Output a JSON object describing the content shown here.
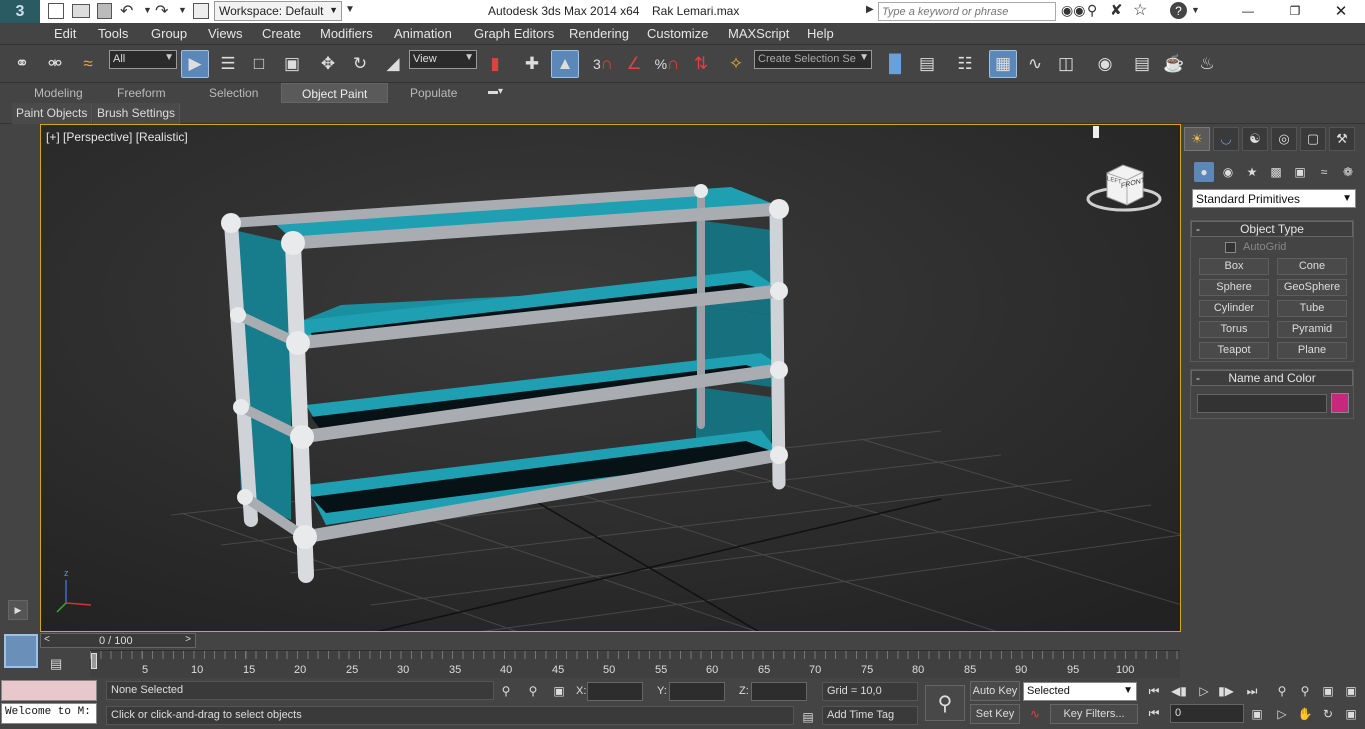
{
  "titlebar": {
    "app_icon_label": "3",
    "workspace_label": "Workspace: Default",
    "app_title": "Autodesk 3ds Max  2014 x64",
    "file_name": "Rak Lemari.max",
    "search_placeholder": "Type a keyword or phrase"
  },
  "menu": [
    "Edit",
    "Tools",
    "Group",
    "Views",
    "Create",
    "Modifiers",
    "Animation",
    "Graph Editors",
    "Rendering",
    "Customize",
    "MAXScript",
    "Help"
  ],
  "toolbar": {
    "selection_filter": "All",
    "ref_coord": "View",
    "named_selection_placeholder": "Create Selection Se",
    "snap_3": "3",
    "snap_pct": "%"
  },
  "ribbon_tabs": [
    "Modeling",
    "Freeform",
    "Selection",
    "Object Paint",
    "Populate"
  ],
  "ribbon_active": "Object Paint",
  "ribbon_panels": [
    "Paint Objects",
    "Brush Settings"
  ],
  "viewport": {
    "label": "[+] [Perspective] [Realistic]",
    "axis_z": "z",
    "viewcube_face": "FRONT",
    "viewcube_left": "LEFT"
  },
  "command_panel": {
    "category": "Standard Primitives",
    "object_type_title": "Object Type",
    "autogrid_label": "AutoGrid",
    "buttons": [
      "Box",
      "Cone",
      "Sphere",
      "GeoSphere",
      "Cylinder",
      "Tube",
      "Torus",
      "Pyramid",
      "Teapot",
      "Plane"
    ],
    "name_color_title": "Name and Color",
    "name_value": "",
    "color": "#c8277e",
    "collapse_symbol": "-"
  },
  "timeline": {
    "frame_display": "0 / 100",
    "ticks": [
      "5",
      "10",
      "15",
      "20",
      "25",
      "30",
      "35",
      "40",
      "45",
      "50",
      "55",
      "60",
      "65",
      "70",
      "75",
      "80",
      "85",
      "90",
      "95",
      "100"
    ]
  },
  "status": {
    "maxscript_listener": "Welcome to M:",
    "selection_info": "None Selected",
    "prompt": "Click or click-and-drag to select objects",
    "x_label": "X:",
    "y_label": "Y:",
    "z_label": "Z:",
    "grid": "Grid = 10,0",
    "add_time_tag": "Add Time Tag",
    "auto_key": "Auto Key",
    "set_key": "Set Key",
    "key_mode": "Selected",
    "key_filters": "Key Filters...",
    "current_frame": "0"
  },
  "colors": {
    "accent": "#5b88b8",
    "viewport_border": "#d8a51a",
    "shelf_teal": "#1f9fb2",
    "pipe_gray": "#a9adb2"
  }
}
